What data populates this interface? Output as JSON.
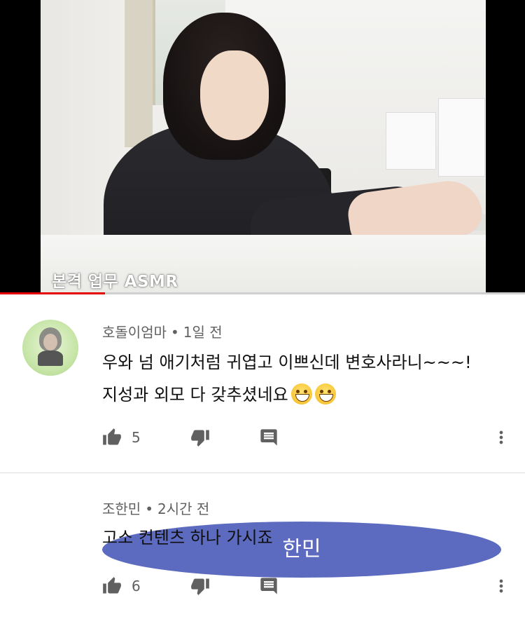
{
  "video": {
    "caption": "본격 업무 ASMR",
    "progress": 0.2
  },
  "comments": [
    {
      "author": "호돌이엄마",
      "age": "1일 전",
      "avatar_type": "image",
      "avatar_icon": "profile-photo-icon",
      "line1": "우와 넘 애기처럼 귀엽고 이쁘신데 변호사라니~~~!",
      "line2": "지성과 외모 다 갖추셨네요",
      "emoji_count": 2,
      "likes": "5"
    },
    {
      "author": "조한민",
      "age": "2시간 전",
      "avatar_type": "text",
      "avatar_text": "한민",
      "avatar_color": "#5c6bc0",
      "line1": "고소 컨텐츠 하나 가시죠",
      "likes": "6"
    }
  ],
  "colors": {
    "progress": "#e60000",
    "meta": "#606060",
    "icon": "#606060"
  }
}
